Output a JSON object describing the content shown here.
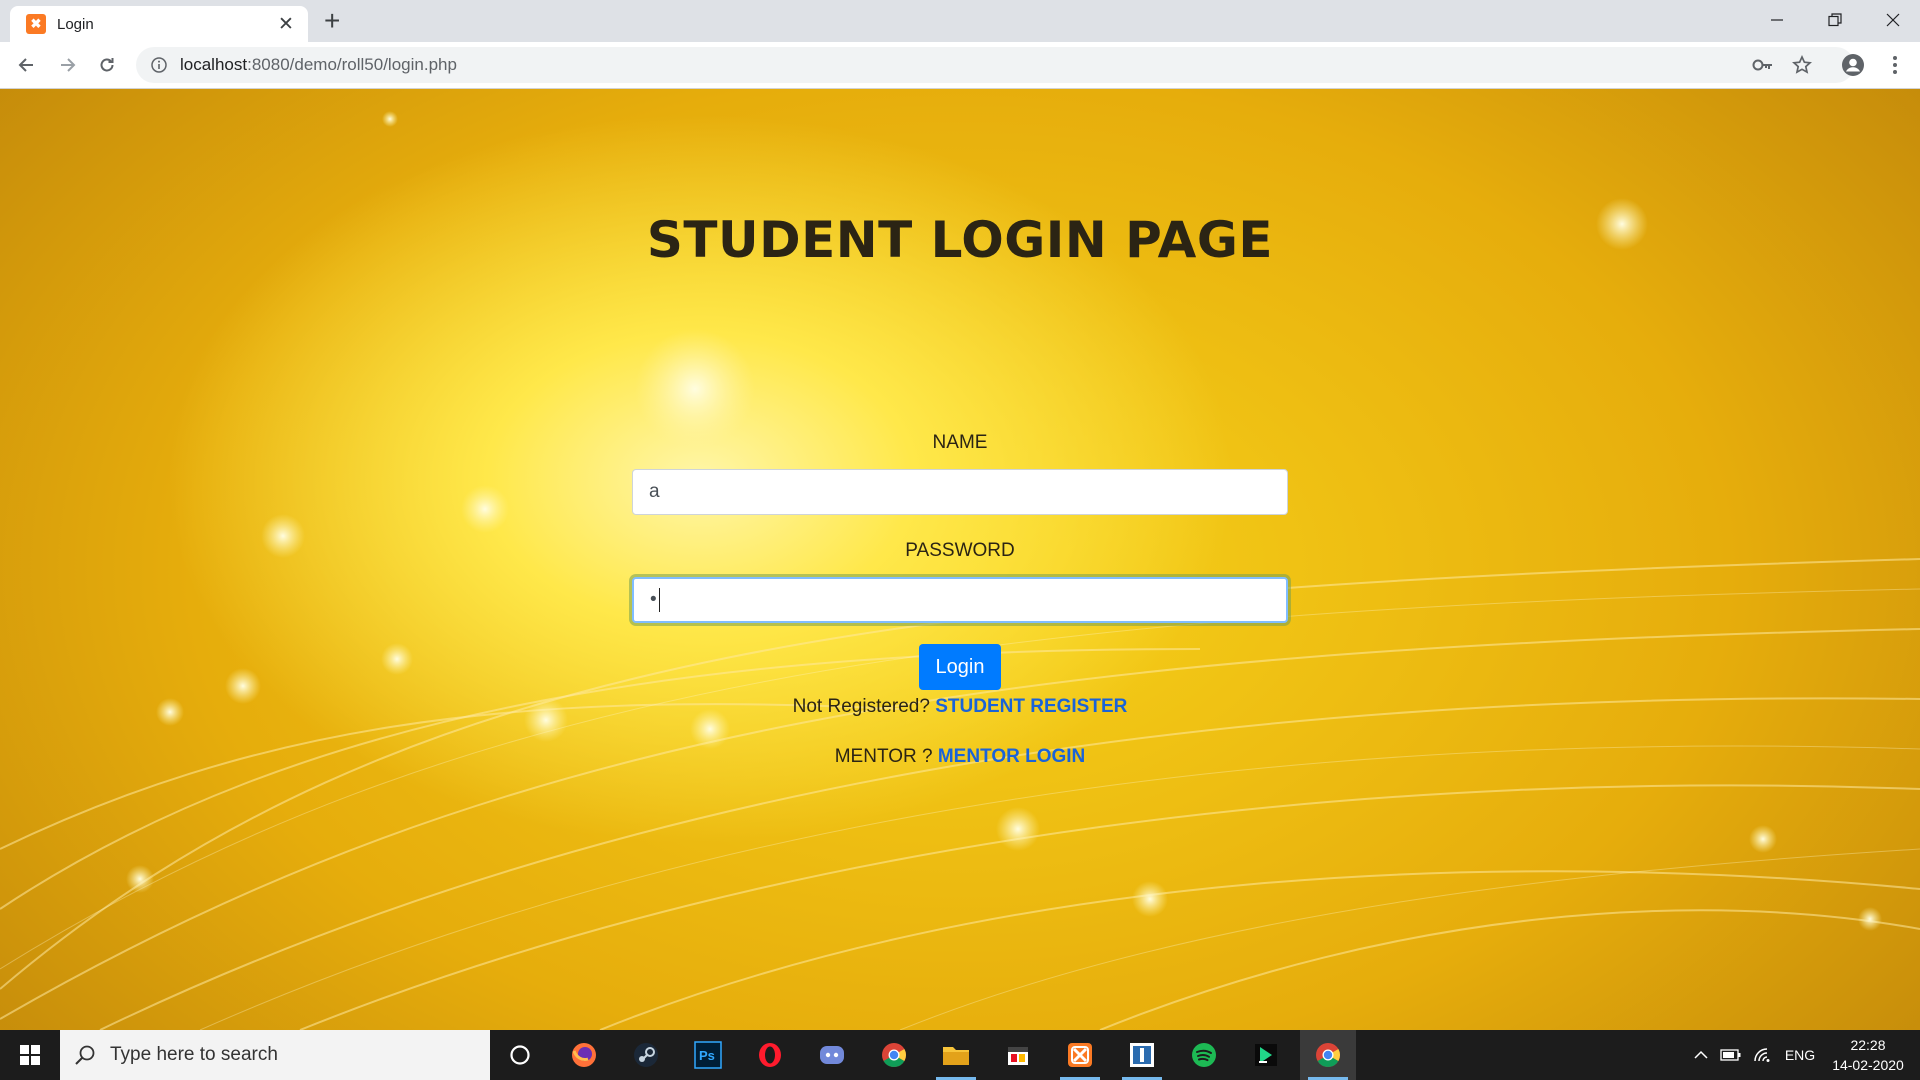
{
  "browser": {
    "tab_title": "Login",
    "tab_favicon": "xampp-icon",
    "url_host": "localhost",
    "url_rest": ":8080/demo/roll50/login.php"
  },
  "page": {
    "title": "STUDENT LOGIN PAGE",
    "name_label": "NAME",
    "name_value": "a",
    "password_label": "PASSWORD",
    "password_value": "•",
    "login_button": "Login",
    "register_prompt": "Not Registered?",
    "register_link": "STUDENT REGISTER",
    "mentor_prompt": "MENTOR ?",
    "mentor_link": "MENTOR LOGIN"
  },
  "taskbar": {
    "search_placeholder": "Type here to search",
    "apps": [
      "cortana-icon",
      "firefox-icon",
      "steam-icon",
      "photoshop-icon",
      "opera-icon",
      "discord-icon",
      "chrome-icon",
      "file-explorer-icon",
      "calendar-app-icon",
      "xampp-icon",
      "editor-icon",
      "spotify-icon",
      "jetbrains-icon",
      "chrome-icon"
    ],
    "language": "ENG",
    "time": "22:28",
    "date": "14-02-2020"
  },
  "colors": {
    "primary_button": "#007bff",
    "link": "#1a63d8",
    "background_gold": "#f7d21a"
  }
}
